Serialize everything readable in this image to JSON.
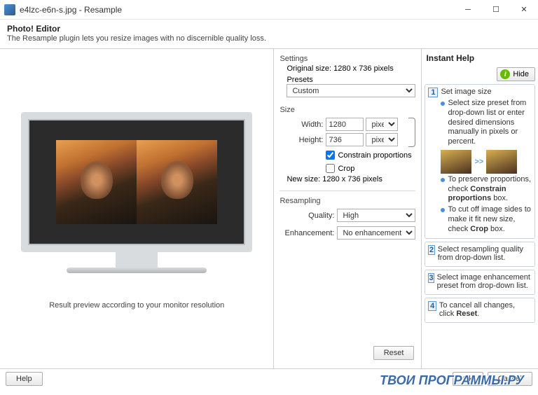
{
  "window": {
    "title": "e4lzc-e6n-s.jpg - Resample"
  },
  "header": {
    "title": "Photo! Editor",
    "subtitle": "The Resample plugin lets you resize images with no discernible quality loss."
  },
  "preview": {
    "caption": "Result preview according to your monitor resolution"
  },
  "settings": {
    "section": "Settings",
    "original_label": "Original size:",
    "original_value": "1280 x 736 pixels",
    "presets_label": "Presets",
    "preset_selected": "Custom",
    "size_label": "Size",
    "width_label": "Width:",
    "width_value": "1280",
    "width_unit": "pixels",
    "height_label": "Height:",
    "height_value": "736",
    "height_unit": "pixels",
    "constrain": "Constrain proportions",
    "constrain_checked": true,
    "crop": "Crop",
    "crop_checked": false,
    "newsize_label": "New size:",
    "newsize_value": "1280 x 736 pixels",
    "resampling_label": "Resampling",
    "quality_label": "Quality:",
    "quality_value": "High",
    "enhance_label": "Enhancement:",
    "enhance_value": "No enhancement",
    "reset": "Reset"
  },
  "help": {
    "title": "Instant Help",
    "hide": "Hide",
    "steps": [
      {
        "num": "1",
        "title": "Set image size",
        "bullets": [
          "Select size preset from drop-down list or enter desired dimensions manually in pixels or percent.",
          "To preserve proportions, check <b>Constrain proportions</b> box.",
          "To cut off image sides to make it fit new size, check <b>Crop</b> box."
        ],
        "thumbs": true
      },
      {
        "num": "2",
        "title": "Select resampling quality from drop-down list.",
        "bullets": []
      },
      {
        "num": "3",
        "title": "Select image enhancement preset from drop-down list.",
        "bullets": []
      },
      {
        "num": "4",
        "title": "To cancel all changes, click <b>Reset</b>.",
        "bullets": []
      }
    ]
  },
  "footer": {
    "help": "Help",
    "ok": "Ok",
    "cancel": "Cancel"
  },
  "watermark": "ТВОИ ПРОГРАММЫ.РУ"
}
